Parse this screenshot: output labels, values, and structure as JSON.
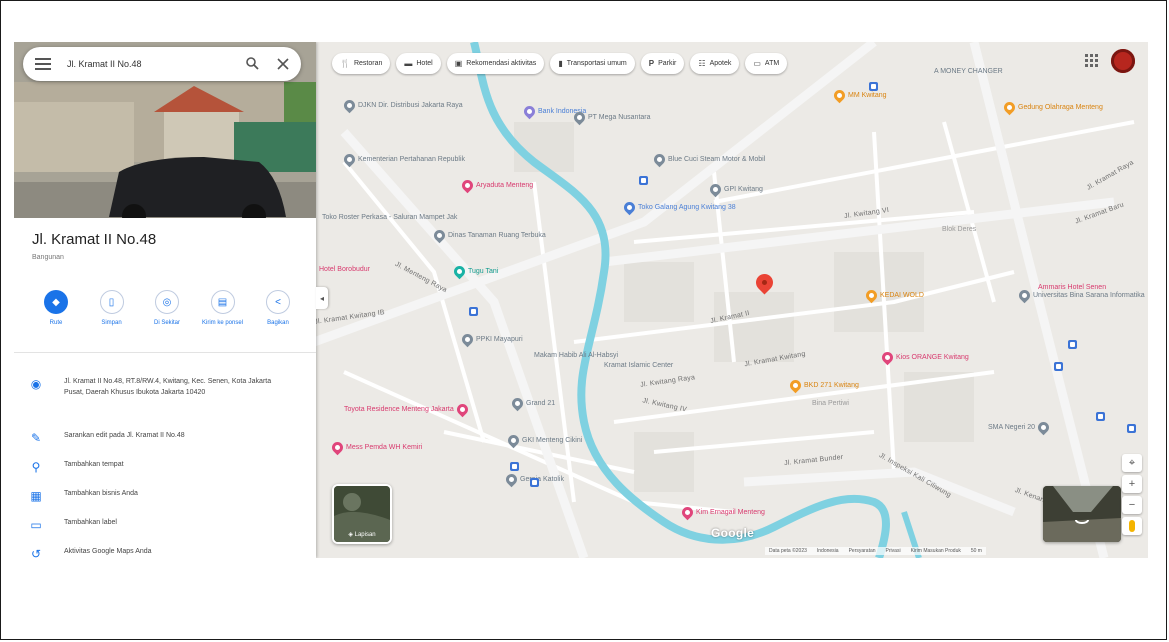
{
  "search": {
    "value": "Jl. Kramat II No.48"
  },
  "place": {
    "title": "Jl. Kramat II No.48",
    "category": "Bangunan"
  },
  "actions": [
    {
      "label": "Rute",
      "icon": "directions-icon"
    },
    {
      "label": "Simpan",
      "icon": "bookmark-icon"
    },
    {
      "label": "Di Sekitar",
      "icon": "nearby-icon"
    },
    {
      "label": "Kirim ke ponsel",
      "icon": "phone-icon"
    },
    {
      "label": "Bagikan",
      "icon": "share-icon"
    }
  ],
  "info": [
    {
      "icon": "location-pin-icon",
      "text": "Jl. Kramat II No.48, RT.8/RW.4, Kwitang, Kec. Senen, Kota Jakarta Pusat, Daerah Khusus Ibukota Jakarta 10420"
    },
    {
      "icon": "pencil-icon",
      "text": "Sarankan edit pada Jl. Kramat II No.48"
    },
    {
      "icon": "add-place-icon",
      "text": "Tambahkan tempat"
    },
    {
      "icon": "business-icon",
      "text": "Tambahkan bisnis Anda"
    },
    {
      "icon": "label-icon",
      "text": "Tambahkan label"
    },
    {
      "icon": "history-icon",
      "text": "Aktivitas Google Maps Anda"
    }
  ],
  "chips": [
    {
      "label": "Restoran",
      "icon": "fork-knife-icon"
    },
    {
      "label": "Hotel",
      "icon": "bed-icon"
    },
    {
      "label": "Rekomendasi aktivitas",
      "icon": "ticket-icon"
    },
    {
      "label": "Transportasi umum",
      "icon": "train-icon"
    },
    {
      "label": "Parkir",
      "icon": "parking-icon"
    },
    {
      "label": "Apotek",
      "icon": "pharmacy-icon"
    },
    {
      "label": "ATM",
      "icon": "atm-icon"
    }
  ],
  "map": {
    "pois": [
      {
        "label": "DJKN Dir. Distribusi Jakarta Raya",
        "color": "gray"
      },
      {
        "label": "Bank Indonesia",
        "color": "purple"
      },
      {
        "label": "PT Mega Nusantara",
        "color": "gray"
      },
      {
        "label": "Kementerian Pertahanan Republik",
        "color": "gray"
      },
      {
        "label": "Aryaduta Menteng",
        "color": "pink"
      },
      {
        "label": "Blue Cuci Steam Motor & Mobil",
        "color": "gray"
      },
      {
        "label": "GPI Kwitang",
        "color": "gray"
      },
      {
        "label": "Toko Galang Agung Kwitang 38",
        "color": "blue"
      },
      {
        "label": "Tugu Tani",
        "color": "teal"
      },
      {
        "label": "Toko Roster Perkasa - Saluran Mampet Jak",
        "color": "gray"
      },
      {
        "label": "Dinas Tanaman Ruang Terbuka",
        "color": "gray"
      },
      {
        "label": "Hotel Borobudur",
        "color": "pink"
      },
      {
        "label": "PPKI Mayapuri",
        "color": "gray"
      },
      {
        "label": "Makam Habib Ali Al-Habsyi",
        "color": "gray"
      },
      {
        "label": "Kramat Islamic Center",
        "color": "gray"
      },
      {
        "label": "KEDAI WOLD",
        "color": "orange"
      },
      {
        "label": "Universitas Bina Sarana Informatika",
        "color": "gray"
      },
      {
        "label": "Kios ORANGE Kwitang",
        "color": "pink"
      },
      {
        "label": "BKD 271 Kwitang",
        "color": "orange"
      },
      {
        "label": "MM Kwitang",
        "color": "orange"
      },
      {
        "label": "Grand 21",
        "color": "gray"
      },
      {
        "label": "Toyota Residence Menteng Jakarta",
        "color": "pink"
      },
      {
        "label": "GKI Menteng Cikini",
        "color": "gray"
      },
      {
        "label": "Mess Pemda WH Kemiri",
        "color": "pink"
      },
      {
        "label": "Ammaris Hotel Senen",
        "color": "pink"
      },
      {
        "label": "A MONEY CHANGER",
        "color": "gray"
      },
      {
        "label": "Gedung Olahraga Menteng",
        "color": "orange"
      },
      {
        "label": "Kim Ernagail Menteng",
        "color": "pink"
      },
      {
        "label": "Gereja Katolik",
        "color": "gray"
      },
      {
        "label": "SMA Negeri 20",
        "color": "gray"
      }
    ],
    "streets": [
      "Jl. Kramat II",
      "Jl. Kwitang Raya",
      "Jl. Kramat Kwitang",
      "Jl. Menteng Raya",
      "Jl. Kwitang IV",
      "Jl. Kwitang VI",
      "Jl. Kramat Kwitang IB",
      "Jl. Kramat Bunder",
      "Jl. Kramat Raya",
      "Jl. Kramat Baru",
      "Jl. Inspeksi Kali Ciliwung",
      "Jl. Kenari"
    ],
    "areas": [
      "Bina Pertiwi",
      "Blok Deres"
    ],
    "layers_label": "Lapisan",
    "google_logo": "Google",
    "footer": [
      "Data peta ©2023",
      "Indonesia",
      "Persyaratan",
      "Privasi",
      "Kirim Masukan Produk",
      "50 m"
    ]
  }
}
